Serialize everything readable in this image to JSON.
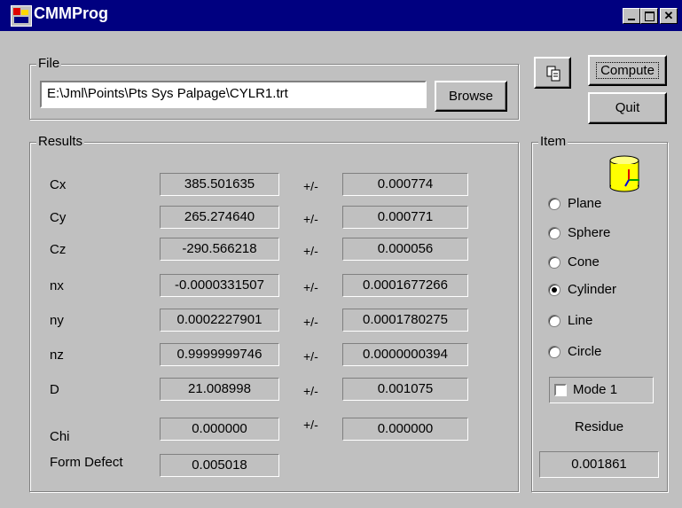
{
  "window": {
    "title": "CMMProg"
  },
  "file": {
    "legend": "File",
    "path": "E:\\Jml\\Points\\Pts Sys Palpage\\CYLR1.trt",
    "browse_label": "Browse"
  },
  "buttons": {
    "compute_label": "Compute",
    "quit_label": "Quit"
  },
  "results": {
    "legend": "Results",
    "pm_label": "+/-",
    "rows": [
      {
        "label": "Cx",
        "value": "385.501635",
        "error": "0.000774"
      },
      {
        "label": "Cy",
        "value": "265.274640",
        "error": "0.000771"
      },
      {
        "label": "Cz",
        "value": "-290.566218",
        "error": "0.000056"
      },
      {
        "label": "nx",
        "value": "-0.0000331507",
        "error": "0.0001677266"
      },
      {
        "label": "ny",
        "value": "0.0002227901",
        "error": "0.0001780275"
      },
      {
        "label": "nz",
        "value": "0.9999999746",
        "error": "0.0000000394"
      },
      {
        "label": "D",
        "value": "21.008998",
        "error": "0.001075"
      },
      {
        "label": "Chi",
        "value": "0.000000",
        "error": "0.000000"
      }
    ],
    "form_defect": {
      "label": "Form Defect",
      "value": "0.005018"
    }
  },
  "item": {
    "legend": "Item",
    "options": [
      {
        "label": "Plane",
        "checked": false
      },
      {
        "label": "Sphere",
        "checked": false
      },
      {
        "label": "Cone",
        "checked": false
      },
      {
        "label": "Cylinder",
        "checked": true
      },
      {
        "label": "Line",
        "checked": false
      },
      {
        "label": "Circle",
        "checked": false
      }
    ],
    "mode_label": "Mode 1",
    "residue_label": "Residue",
    "residue_value": "0.001861"
  },
  "icons": {
    "app": "app-icon",
    "copy": "copy-icon",
    "cylinder": "cylinder-icon"
  }
}
